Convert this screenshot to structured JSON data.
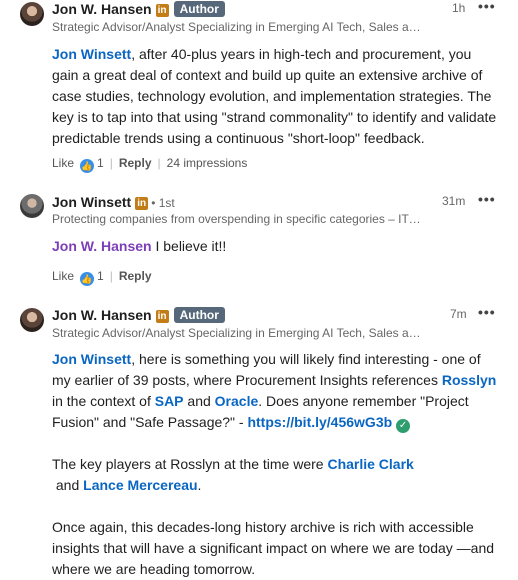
{
  "comments": [
    {
      "name": "Jon W. Hansen",
      "li_badge": "in",
      "author_badge": "Author",
      "degree": "",
      "headline": "Strategic Advisor/Analyst Specializing in Emerging AI Tech, Sales and M...",
      "time": "1h",
      "dots": "•••",
      "body": {
        "mention": "Jon Winsett",
        "text": ", after 40-plus years in high-tech and procurement, you gain a great deal of context and build up quite an extensive archive of case studies, technology evolution, and implementation strategies. The key is to tap into that using \"strand commonality\" to identify and validate predictable trends using a continuous \"short-loop\" feedback."
      },
      "actions": {
        "like": "Like",
        "like_count": "1",
        "reply": "Reply",
        "impressions": "24 impressions"
      }
    },
    {
      "name": "Jon Winsett",
      "li_badge": "in",
      "degree": "• 1st",
      "headline": "Protecting companies from overspending in specific categories – IT a...",
      "time": "31m",
      "dots": "•••",
      "body": {
        "mention": "Jon W. Hansen",
        "text": " I believe it!!"
      },
      "actions": {
        "like": "Like",
        "like_count": "1",
        "reply": "Reply"
      }
    },
    {
      "name": "Jon W. Hansen",
      "li_badge": "in",
      "author_badge": "Author",
      "headline": "Strategic Advisor/Analyst Specializing in Emerging AI Tech, Sales and ...",
      "time": "7m",
      "dots": "•••",
      "body": {
        "p1": {
          "m1": "Jon Winsett",
          "t1": ", here is something you will likely find interesting - one of my earlier of 39 posts, where Procurement Insights references ",
          "m2": "Rosslyn",
          "t2": " in the context of ",
          "m3": "SAP",
          "t3": " and ",
          "m4": "Oracle",
          "t4": ". Does anyone remember \"Project Fusion\" and \"Safe Passage?\" - ",
          "link": "https://bit.ly/456wG3b"
        },
        "p2": {
          "t1": "The key players at Rosslyn at the time were ",
          "m1": "Charlie Clark",
          "t2": "and ",
          "m2": "Lance Mercereau",
          "t3": "."
        },
        "p3": "Once again, this decades-long history archive is rich with accessible insights that will have a significant impact on where we are today —and where we are heading tomorrow."
      }
    }
  ],
  "colors": {
    "link_blue": "#0a66c2",
    "mention_purple": "#7d3fb8",
    "li_orange": "#c37d16",
    "author_grey": "#56687a"
  }
}
